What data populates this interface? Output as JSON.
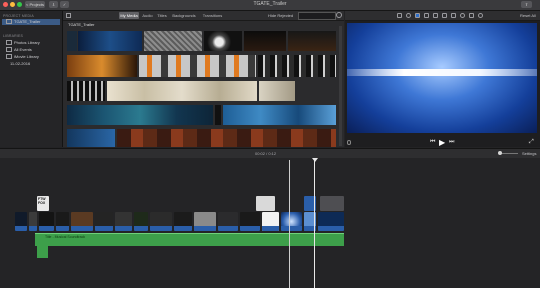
{
  "titlebar": {
    "back_label": "< Projects",
    "title": "TGATE_Trailer",
    "traffic_colors": [
      "#fc605b",
      "#fdbc40",
      "#34c84a"
    ]
  },
  "sidebar": {
    "project_media_heading": "PROJECT MEDIA",
    "project_item": "TGATE_Trailer",
    "libraries_heading": "LIBRARIES",
    "items": [
      {
        "label": "Photos Library"
      },
      {
        "label": "All Events"
      },
      {
        "label": "iMovie Library"
      },
      {
        "label": "11-02-2016"
      }
    ]
  },
  "browser": {
    "tabs": [
      "My Media",
      "Audio",
      "Titles",
      "Backgrounds",
      "Transitions"
    ],
    "active_tab": "My Media",
    "header_label": "TGATE_Trailer",
    "filter_label": "Hide Rejected",
    "search_icon": "search-icon"
  },
  "viewer": {
    "reset_all": "Reset All",
    "toolbar_icons": [
      "magic-wand-icon",
      "color-balance-icon",
      "color-correction-icon",
      "crop-icon",
      "stabilization-icon",
      "volume-icon",
      "noise-reduction-icon",
      "speed-icon",
      "filter-icon",
      "info-icon"
    ]
  },
  "timeline": {
    "timecode": "00:02 / 0:12",
    "settings_label": "Settings",
    "title_clip_label": "FTW FOX",
    "audio_label": "Title - Musical Soundtrack"
  }
}
